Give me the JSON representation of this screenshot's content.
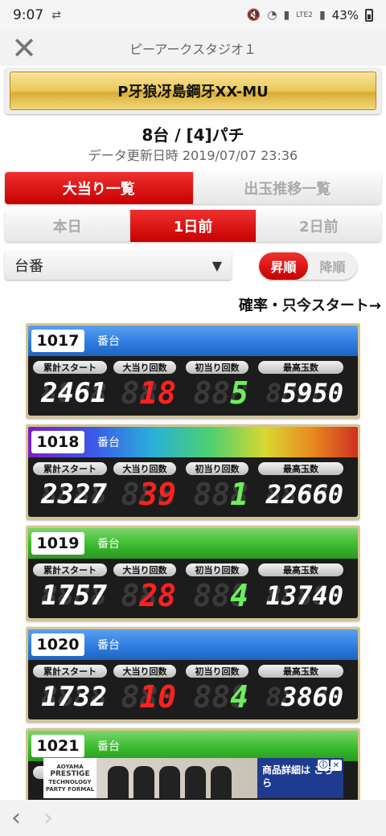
{
  "status": {
    "time": "9:07",
    "battery": "43%",
    "network": "LTE2"
  },
  "app": {
    "title": "ピーアークスタジオ１"
  },
  "machine": {
    "name": "P牙狼冴島鋼牙XX-MU",
    "summary": "8台 / [4]パチ",
    "updated": "データ更新日時 2019/07/07 23:36"
  },
  "main_tabs": [
    {
      "label": "大当り一覧",
      "active": true
    },
    {
      "label": "出玉推移一覧",
      "active": false
    }
  ],
  "day_tabs": [
    {
      "label": "本日",
      "active": false
    },
    {
      "label": "1日前",
      "active": true
    },
    {
      "label": "2日前",
      "active": false
    }
  ],
  "sort": {
    "field": "台番",
    "asc_label": "昇順",
    "desc_label": "降順",
    "selected": "asc"
  },
  "hint": "確率・只今スタート→",
  "stat_labels": [
    "累計スタート",
    "大当り回数",
    "初当り回数",
    "最高玉数"
  ],
  "unit_label": "番台",
  "machines": [
    {
      "number": "1017",
      "header_style": "blue",
      "cumulative_start": "2461",
      "jackpots": "18",
      "first_hits": "5",
      "max_balls": "5950"
    },
    {
      "number": "1018",
      "header_style": "rainbow",
      "cumulative_start": "2327",
      "jackpots": "39",
      "first_hits": "1",
      "max_balls": "22660"
    },
    {
      "number": "1019",
      "header_style": "green",
      "cumulative_start": "1757",
      "jackpots": "28",
      "first_hits": "4",
      "max_balls": "13740"
    },
    {
      "number": "1020",
      "header_style": "blue",
      "cumulative_start": "1732",
      "jackpots": "10",
      "first_hits": "4",
      "max_balls": "3860"
    },
    {
      "number": "1021",
      "header_style": "green",
      "cumulative_start": "",
      "jackpots": "",
      "first_hits": "",
      "max_balls": ""
    }
  ],
  "ad": {
    "logo_lines": [
      "AOYAMA",
      "PRESTIGE",
      "TECHNOLOGY",
      "PARTY FORMAL"
    ],
    "text": "商品詳細は こちら"
  },
  "colors": {
    "accent_red": "#d81010",
    "blue_header": "#2e7de0",
    "green_header": "#3bbb2e",
    "gold": "#e9c85a",
    "digit_white": "#ffffff",
    "digit_red": "#ff2020",
    "digit_green": "#6cf05a"
  }
}
